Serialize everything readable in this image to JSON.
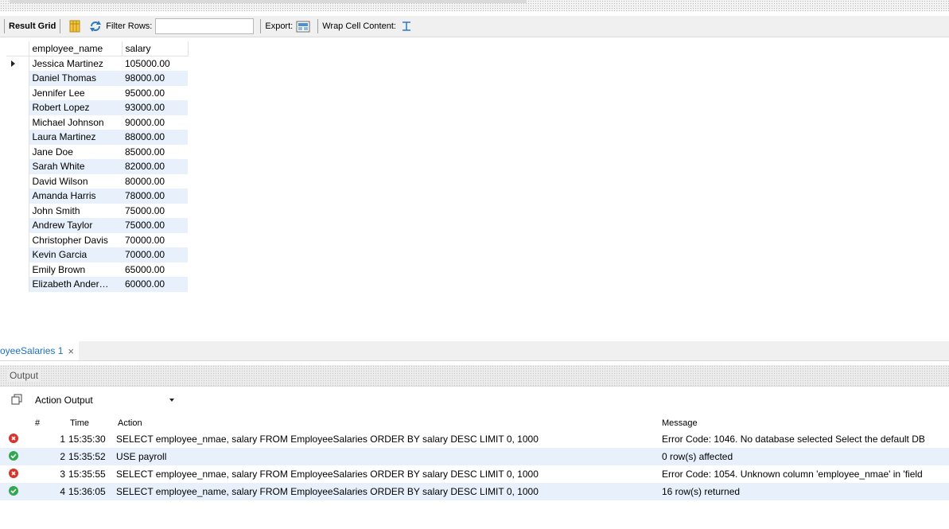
{
  "toolbar": {
    "result_grid_label": "Result Grid",
    "filter_rows_label": "Filter Rows:",
    "filter_value": "",
    "export_label": "Export:",
    "wrap_cell_label": "Wrap Cell Content:"
  },
  "grid": {
    "columns": [
      "employee_name",
      "salary"
    ],
    "rows": [
      [
        "Jessica Martinez",
        "105000.00"
      ],
      [
        "Daniel Thomas",
        "98000.00"
      ],
      [
        "Jennifer Lee",
        "95000.00"
      ],
      [
        "Robert Lopez",
        "93000.00"
      ],
      [
        "Michael Johnson",
        "90000.00"
      ],
      [
        "Laura Martinez",
        "88000.00"
      ],
      [
        "Jane Doe",
        "85000.00"
      ],
      [
        "Sarah White",
        "82000.00"
      ],
      [
        "David Wilson",
        "80000.00"
      ],
      [
        "Amanda Harris",
        "78000.00"
      ],
      [
        "John Smith",
        "75000.00"
      ],
      [
        "Andrew Taylor",
        "75000.00"
      ],
      [
        "Christopher Davis",
        "70000.00"
      ],
      [
        "Kevin Garcia",
        "70000.00"
      ],
      [
        "Emily Brown",
        "65000.00"
      ],
      [
        "Elizabeth Ander…",
        "60000.00"
      ]
    ]
  },
  "tab": {
    "label": "oyeeSalaries 1",
    "close": "×"
  },
  "output": {
    "title": "Output",
    "selector_value": "Action Output",
    "columns": {
      "num": "#",
      "time": "Time",
      "action": "Action",
      "message": "Message"
    },
    "rows": [
      {
        "status": "error",
        "num": "1",
        "time": "15:35:30",
        "action": "SELECT employee_nmae, salary  FROM EmployeeSalaries ORDER BY salary DESC LIMIT 0, 1000",
        "message": "Error Code: 1046. No database selected Select the default DB"
      },
      {
        "status": "ok",
        "num": "2",
        "time": "15:35:52",
        "action": "USE payroll",
        "message": "0 row(s) affected"
      },
      {
        "status": "error",
        "num": "3",
        "time": "15:35:55",
        "action": "SELECT employee_nmae, salary  FROM EmployeeSalaries ORDER BY salary DESC LIMIT 0, 1000",
        "message": "Error Code: 1054. Unknown column 'employee_nmae' in 'field"
      },
      {
        "status": "ok",
        "num": "4",
        "time": "15:36:05",
        "action": "SELECT employee_name, salary  FROM EmployeeSalaries ORDER BY salary DESC LIMIT 0, 1000",
        "message": "16 row(s) returned"
      }
    ]
  },
  "colors": {
    "row_alt": "#e8f1fb",
    "tab_text": "#1a6fc4",
    "error": "#d9342b",
    "ok": "#2fa84f"
  }
}
